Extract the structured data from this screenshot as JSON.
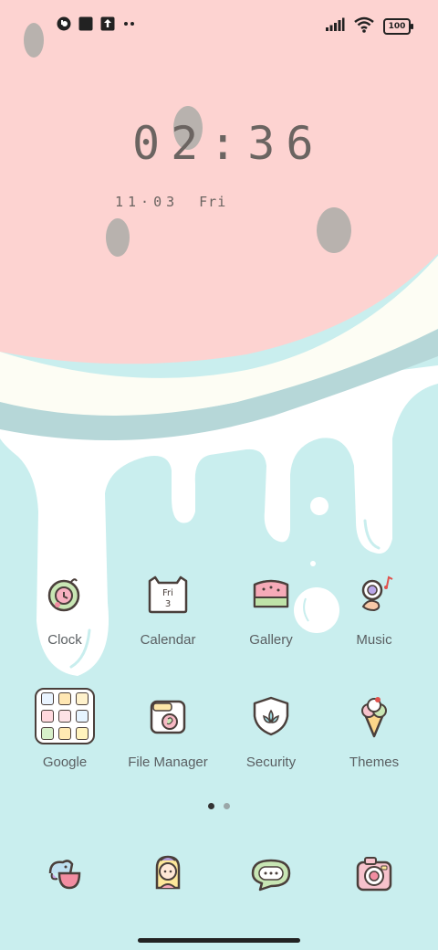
{
  "status_bar": {
    "battery_level": "100",
    "icons": [
      "notification-app-icon",
      "square-notification-icon",
      "upload-icon",
      "more-notifications-icon",
      "signal-icon",
      "wifi-icon",
      "battery-icon"
    ]
  },
  "lockscreen_widget": {
    "time": "02:36",
    "date": "11·03",
    "weekday": "Fri"
  },
  "home": {
    "apps_row1": [
      {
        "label": "Clock",
        "icon": "clock-icon"
      },
      {
        "label": "Calendar",
        "icon": "calendar-icon"
      },
      {
        "label": "Gallery",
        "icon": "gallery-icon"
      },
      {
        "label": "Music",
        "icon": "music-icon"
      }
    ],
    "apps_row2": [
      {
        "label": "Google",
        "icon": "google-folder-icon"
      },
      {
        "label": "File Manager",
        "icon": "file-manager-icon"
      },
      {
        "label": "Security",
        "icon": "security-icon"
      },
      {
        "label": "Themes",
        "icon": "themes-icon"
      }
    ],
    "calendar_icon_text": {
      "day": "Fri",
      "num": "3"
    },
    "page_indicator": {
      "pages": 2,
      "current": 1
    }
  },
  "dock": {
    "apps": [
      {
        "icon": "phone-bird-icon"
      },
      {
        "icon": "contacts-girl-icon"
      },
      {
        "icon": "messages-bubble-icon"
      },
      {
        "icon": "camera-icon"
      }
    ]
  },
  "colors": {
    "pink": "#fdd3d1",
    "cream": "#fdfdf4",
    "blue_band": "#b6d7d8",
    "mint": "#c9eeee",
    "text": "#5a5f62"
  }
}
